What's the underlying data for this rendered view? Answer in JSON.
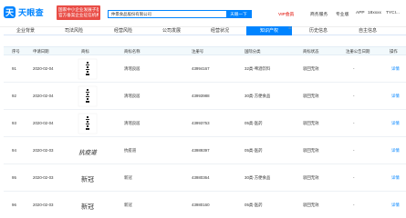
{
  "header": {
    "logo_mark": "天",
    "logo_text": "天眼查",
    "notice": [
      "国家中小企业发展子基金旗下",
      "官方备案企业征信机构"
    ],
    "search_value": "仲景食品股份有限公司",
    "search_button": "天眼一下",
    "nav": {
      "vip": "VIP会员",
      "business": "商务服务",
      "pro": "专业版",
      "app": "APP",
      "user": "18xxxx",
      "company": "TYCI..."
    }
  },
  "tabs": [
    {
      "label": "企业背景",
      "count": ""
    },
    {
      "label": "司法风险",
      "count": ""
    },
    {
      "label": "经营风险",
      "count": ""
    },
    {
      "label": "公司发展",
      "count": ""
    },
    {
      "label": "经营状况",
      "count": ""
    },
    {
      "label": "知识产权",
      "count": "40"
    },
    {
      "label": "历史信息",
      "count": ""
    },
    {
      "label": "自主信息",
      "count": ""
    }
  ],
  "table": {
    "columns": [
      "序号",
      "申请日期",
      "商标",
      "商标名称",
      "注册号",
      "国际分类",
      "商标状态",
      "注册公告日期",
      "操作"
    ],
    "rows": [
      {
        "index": "91",
        "date": "2020-02-04",
        "name": "清瑶良居",
        "reg_no": "43994167",
        "category": "32类-啤酒饮料",
        "status": "驳回无效",
        "pub_date": "-",
        "action": "详情"
      },
      {
        "index": "92",
        "date": "2020-02-04",
        "name": "清瑶良居",
        "reg_no": "43993988",
        "category": "30类-方便食品",
        "status": "驳回无效",
        "pub_date": "-",
        "action": "详情"
      },
      {
        "index": "93",
        "date": "2020-02-04",
        "name": "清瑶良居",
        "reg_no": "43993753",
        "category": "05类-医药",
        "status": "驳回无效",
        "pub_date": "-",
        "action": "详情"
      },
      {
        "index": "94",
        "date": "2020-02-03",
        "name": "抗疫道",
        "reg_no": "43989397",
        "category": "05类-医药",
        "status": "驳回无效",
        "pub_date": "-",
        "action": "详情"
      },
      {
        "index": "95",
        "date": "2020-02-03",
        "name": "新冠",
        "reg_no": "43980364",
        "category": "30类-方便食品",
        "status": "驳回无效",
        "pub_date": "-",
        "action": "详情"
      },
      {
        "index": "96",
        "date": "2020-02-03",
        "name": "新冠",
        "reg_no": "43980160",
        "category": "05类-医药",
        "status": "驳回无效",
        "pub_date": "-",
        "action": "详情"
      }
    ]
  },
  "logos": {
    "xinguan": "新冠",
    "kangyidao": "抗疫道"
  },
  "colors": {
    "brand": "#0084ff",
    "notice_red": "#e94d46",
    "table_header_bg": "#f2f9fc"
  }
}
